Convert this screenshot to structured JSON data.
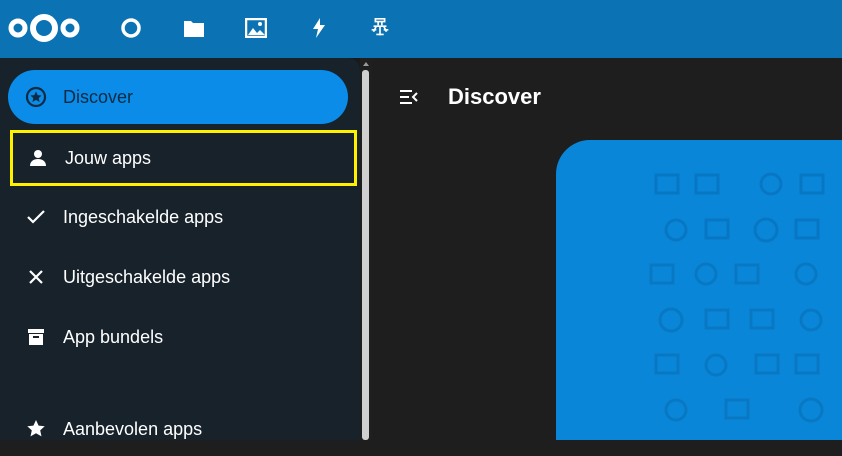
{
  "topbar": {
    "logo_icon": "nextcloud-logo",
    "apps": [
      {
        "name": "dashboard-icon"
      },
      {
        "name": "files-icon"
      },
      {
        "name": "photos-icon"
      },
      {
        "name": "activity-icon"
      },
      {
        "name": "apps-icon"
      }
    ]
  },
  "sidebar": {
    "items": [
      {
        "label": "Discover",
        "icon": "star-circle-icon",
        "active": true
      },
      {
        "label": "Jouw apps",
        "icon": "user-icon",
        "highlighted": true
      },
      {
        "label": "Ingeschakelde apps",
        "icon": "check-icon"
      },
      {
        "label": "Uitgeschakelde apps",
        "icon": "close-icon"
      },
      {
        "label": "App bundels",
        "icon": "archive-icon"
      },
      {
        "label": "Aanbevolen apps",
        "icon": "star-icon"
      }
    ]
  },
  "main": {
    "title": "Discover"
  },
  "colors": {
    "topbar": "#0b73b3",
    "accent": "#0b8ce9",
    "highlight": "#fff200",
    "hero": "#0a86d8"
  }
}
